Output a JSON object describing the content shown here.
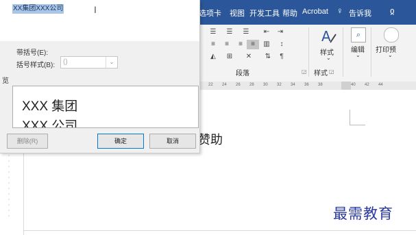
{
  "ribbon": {
    "tabs": [
      "选项卡",
      "视图",
      "开发工具",
      "帮助",
      "Acrobat",
      "告诉我"
    ],
    "paragraph_group_label": "段落",
    "styles_button_label": "样式",
    "styles_group_label": "样式",
    "edit_button_label": "编辑",
    "print_preview_label": "打印预"
  },
  "ruler": {
    "numbers": [
      "22",
      "24",
      "26",
      "28",
      "30",
      "32",
      "34",
      "36",
      "38",
      "40",
      "42",
      "44"
    ]
  },
  "dialog": {
    "selected_text": "XX集团XXX公司",
    "number_with_parens_label": "带括号(E):",
    "number_style_label": "括号样式(B):",
    "number_style_value": "()",
    "preview_label": "览",
    "preview_lines": [
      "XXX 集团",
      "XXX 公司"
    ],
    "delete_button": "删除(R)",
    "ok_button": "确定",
    "cancel_button": "取消"
  },
  "document": {
    "body_text": "赞助"
  },
  "watermark": "最需教育"
}
